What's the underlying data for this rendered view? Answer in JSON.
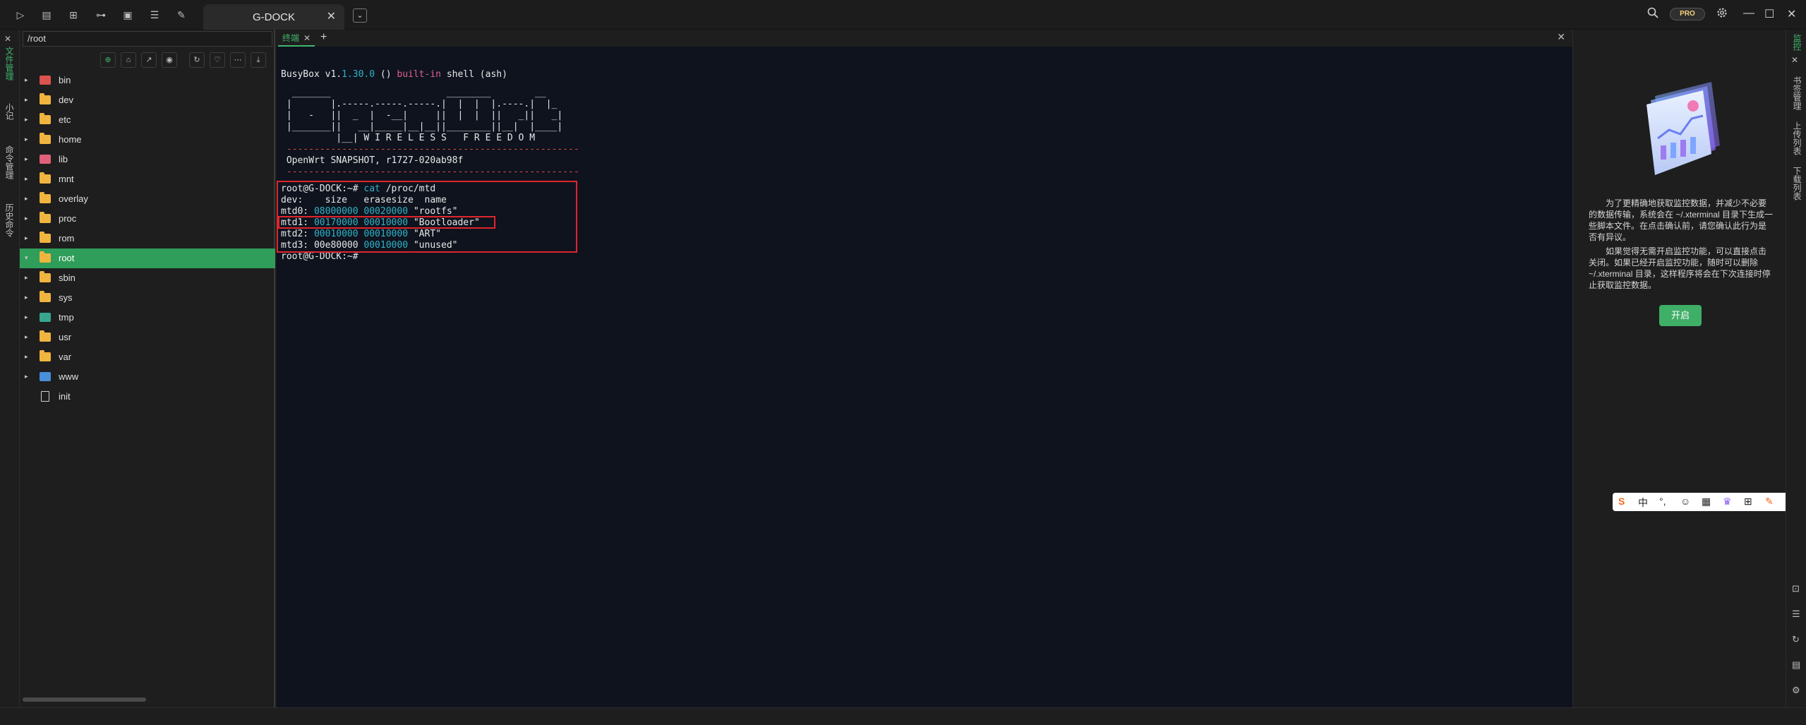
{
  "titlebar": {
    "session_tab": "G-DOCK",
    "session_close": "✕",
    "dropdown": "⌄",
    "pro_badge": "PRO",
    "icons_left": [
      "▷",
      "▤",
      "⊞",
      "⊶",
      "▣",
      "☰",
      "✎"
    ],
    "minimize": "—",
    "maximize": "☐",
    "close": "✕"
  },
  "left_strip": {
    "close": "✕",
    "tabs": [
      "文件管理",
      "小记",
      "命令管理",
      "历史命令"
    ]
  },
  "file_panel": {
    "path": "/root",
    "toolbar_icons": [
      "⊕",
      "⌂",
      "↗",
      "◉",
      "↻",
      "♡",
      "⋯",
      "⤓"
    ],
    "items": [
      {
        "name": "bin",
        "type": "red",
        "arrow": "▸"
      },
      {
        "name": "dev",
        "type": "folder",
        "arrow": "▸"
      },
      {
        "name": "etc",
        "type": "folder",
        "arrow": "▸"
      },
      {
        "name": "home",
        "type": "folder",
        "arrow": "▸"
      },
      {
        "name": "lib",
        "type": "pink",
        "arrow": "▸"
      },
      {
        "name": "mnt",
        "type": "folder",
        "arrow": "▸"
      },
      {
        "name": "overlay",
        "type": "folder",
        "arrow": "▸"
      },
      {
        "name": "proc",
        "type": "folder",
        "arrow": "▸"
      },
      {
        "name": "rom",
        "type": "folder",
        "arrow": "▸"
      },
      {
        "name": "root",
        "type": "folder",
        "arrow": "▾",
        "selected": true
      },
      {
        "name": "sbin",
        "type": "folder",
        "arrow": "▸"
      },
      {
        "name": "sys",
        "type": "folder",
        "arrow": "▸"
      },
      {
        "name": "tmp",
        "type": "teal",
        "arrow": "▸"
      },
      {
        "name": "usr",
        "type": "folder",
        "arrow": "▸"
      },
      {
        "name": "var",
        "type": "folder",
        "arrow": "▸"
      },
      {
        "name": "www",
        "type": "blue",
        "arrow": "▸"
      },
      {
        "name": "init",
        "type": "file",
        "arrow": ""
      }
    ]
  },
  "terminal": {
    "tab_label": "终端",
    "tab_close": "✕",
    "add": "+",
    "panel_close": "✕",
    "lines": [
      "BusyBox v1.30.0 () built-in shell (ash)",
      "  _______                     ________        __",
      " |       |.-----.-----.-----.|  |  |  |.----.|  |_",
      " |   -   ||  _  |  -__|     ||  |  |  ||   _||   _|",
      " |_______||   __|_____|__|__||________||__|  |____|",
      "          |__| W I R E L E S S   F R E E D O M",
      " -----------------------------------------------------",
      " OpenWrt SNAPSHOT, r1727-020ab98f",
      " -----------------------------------------------------",
      "root@G-DOCK:~# cat /proc/mtd",
      "dev:    size   erasesize  name",
      "mtd0: 08000000 00020000 \"rootfs\"",
      "mtd1: 00170000 00010000 \"Bootloader\"",
      "mtd2: 00010000 00010000 \"ART\"",
      "mtd3: 00e80000 00010000 \"unused\"",
      "root@G-DOCK:~# "
    ],
    "busybox_version": "1.30.0",
    "builtin_word": "built-in",
    "command": "cat"
  },
  "monitor": {
    "para1": "为了更精确地获取监控数据，并减少不必要的数据传输，系统会在 ~/.xterminal 目录下生成一些脚本文件。在点击确认前，请您确认此行为是否有异议。",
    "para2": "如果觉得无需开启监控功能，可以直接点击关闭。如果已经开启监控功能，随时可以删除 ~/.xterminal 目录，这样程序将会在下次连接时停止获取监控数据。",
    "open_button": "开启",
    "ime": [
      "S",
      "中",
      "°,",
      "☺",
      "▦",
      "♛",
      "⊞",
      "✎"
    ]
  },
  "right_strip": {
    "tabs": [
      "监控",
      "书签管理",
      "上传列表",
      "下载列表"
    ],
    "close": "✕",
    "bottom_icons": [
      "⊡",
      "☰",
      "↻",
      "▤",
      "⚙"
    ]
  },
  "colors": {
    "accent": "#3fb56c",
    "terminal_bg": "#0e131e",
    "highlight": "#e0252c",
    "cyan": "#2fb4c8"
  }
}
